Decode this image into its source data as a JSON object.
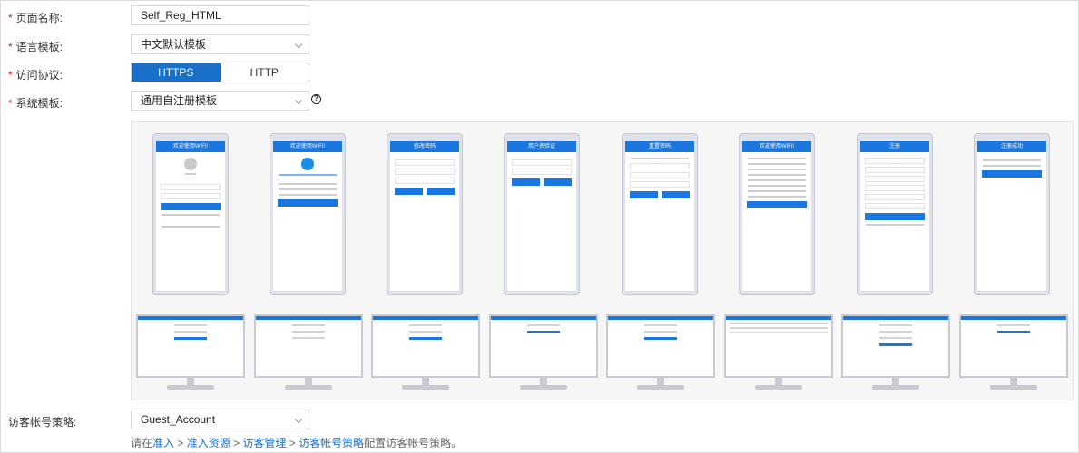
{
  "form": {
    "page_name": {
      "label": "页面名称:",
      "value": "Self_Reg_HTML"
    },
    "language_template": {
      "label": "语言模板:",
      "value": "中文默认模板"
    },
    "protocol": {
      "label": "访问协议:",
      "options": [
        "HTTPS",
        "HTTP"
      ],
      "selected": "HTTPS"
    },
    "system_template": {
      "label": "系统模板:",
      "value": "通用自注册模板"
    },
    "guest_policy": {
      "label": "访客帐号策略:",
      "value": "Guest_Account"
    }
  },
  "hint": {
    "prefix": "请在",
    "links": [
      "准入",
      "准入资源",
      "访客管理",
      "访客帐号策略"
    ],
    "separator": " > ",
    "suffix": "配置访客帐号策略。"
  },
  "templates": {
    "phones": [
      {
        "title": "欢迎使用WIFI!"
      },
      {
        "title": "欢迎使用WIFI!"
      },
      {
        "title": "修改密码"
      },
      {
        "title": "用户名验证"
      },
      {
        "title": "重置密码"
      },
      {
        "title": "欢迎使用WIFI!"
      },
      {
        "title": "注册"
      },
      {
        "title": "注册成功"
      }
    ]
  },
  "colors": {
    "accent": "#1a6fc6",
    "required": "#e02020"
  }
}
